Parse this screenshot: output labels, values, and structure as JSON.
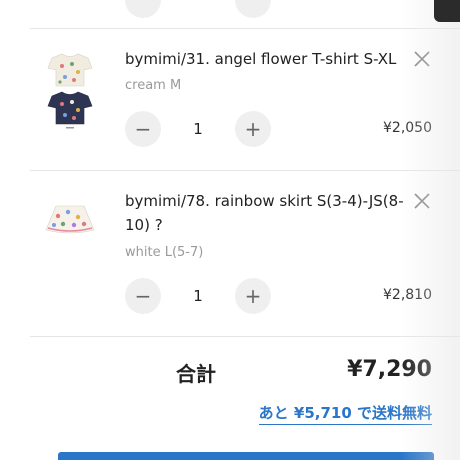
{
  "cart": {
    "items": [
      {
        "title": "bymimi/31. angel flower T-shirt S-XL",
        "variant": "cream M",
        "quantity": "1",
        "price": "¥2,050",
        "minus_label": "−",
        "plus_label": "+"
      },
      {
        "title": "bymimi/78. rainbow skirt S(3-4)-JS(8-10) ?",
        "variant": "white L(5-7)",
        "quantity": "1",
        "price": "¥2,810",
        "minus_label": "−",
        "plus_label": "+"
      }
    ],
    "total_label": "合計",
    "total_value": "¥7,290",
    "shipping_note": "あと ¥5,710 で送料無料"
  },
  "colors": {
    "accent": "#2a76c9",
    "stepper_bg": "#efefef",
    "muted_text": "#9a9a9a"
  },
  "icons": {
    "remove": "close-icon",
    "minus": "minus-icon",
    "plus": "plus-icon"
  }
}
